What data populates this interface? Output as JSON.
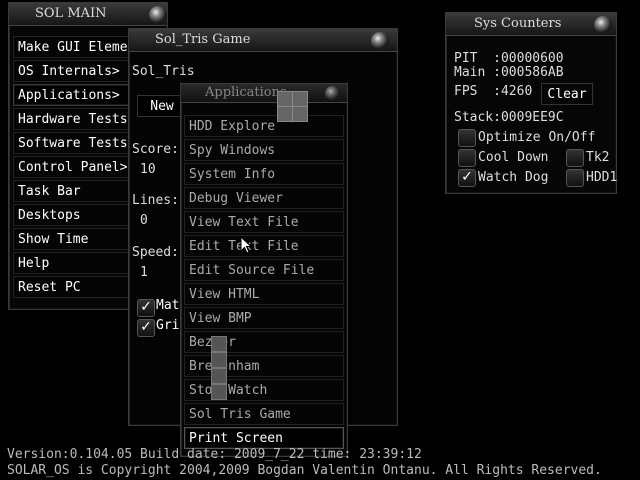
{
  "sol_main": {
    "title": "SOL MAIN",
    "items": [
      "Make GUI Eleme",
      "OS Internals>",
      "Applications>",
      "Hardware Tests>",
      "Software Tests>",
      "Control Panel>",
      "Task Bar",
      "Desktops",
      "Show Time",
      "Help",
      "Reset PC"
    ]
  },
  "tris": {
    "title": "Sol_Tris Game",
    "subtitle": "Sol_Tris",
    "new_label": "New",
    "score_label": "Score:",
    "score_value": "10",
    "lines_label": "Lines:",
    "lines_value": "0",
    "speed_label": "Speed:",
    "speed_value": "1",
    "matrix_label": "Matrix",
    "grid_label": "Grid"
  },
  "apps": {
    "title": "Applications",
    "items": [
      "HDD Explore",
      "Spy Windows",
      "System Info",
      "Debug Viewer",
      "View Text File",
      "Edit Text File",
      "Edit Source File",
      "View HTML",
      "View BMP",
      "Bezier",
      "Bresenham",
      "Stop Watch",
      "Sol Tris Game",
      "Print Screen"
    ]
  },
  "sys": {
    "title": "Sys Counters",
    "pit": "PIT  :00000600",
    "main": "Main :000586AB",
    "fps": "FPS  :4260",
    "clear_label": "Clear",
    "stack": "Stack:0009EE9C",
    "optimize": "Optimize On/Off",
    "cooldown": "Cool Down",
    "tk2": "Tk2",
    "watchdog": "Watch Dog",
    "hdd1": "HDD1"
  },
  "footer": {
    "version": "Version:0.104.05  Build date: 2009_7_22  time: 23:39:12",
    "copyright": "SOLAR_OS is Copyright 2004,2009 Bogdan Valentin Ontanu. All Rights Reserved."
  }
}
